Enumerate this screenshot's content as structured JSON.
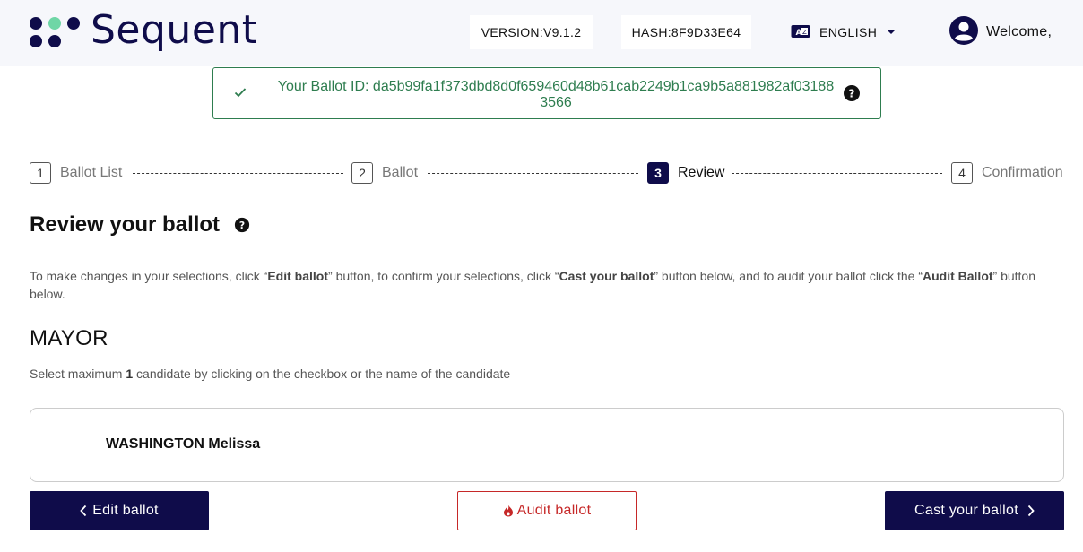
{
  "header": {
    "brand": "Sequent",
    "version": "VERSION:V9.1.2",
    "hash": "HASH:8F9D33E64",
    "language": "ENGLISH",
    "welcome": "Welcome,"
  },
  "banner": {
    "ballot_id_line1": "Your Ballot ID: da5b99fa1f373dbd8d0f659460d48b61cab2249b1ca9b5a881982af03188",
    "ballot_id_line2": "3566"
  },
  "stepper": {
    "steps": [
      {
        "number": "1",
        "label": "Ballot List",
        "state": "done"
      },
      {
        "number": "2",
        "label": "Ballot",
        "state": "done"
      },
      {
        "number": "3",
        "label": "Review",
        "state": "active"
      },
      {
        "number": "4",
        "label": "Confirmation",
        "state": "pending"
      }
    ]
  },
  "review": {
    "title": "Review your ballot",
    "instructions": {
      "p1": "To make changes in your selections, click “",
      "b1": "Edit ballot",
      "p2": "” button, to confirm your selections, click “",
      "b2": "Cast your ballot",
      "p3": "” button below, and to audit your ballot click the “",
      "b3": "Audit Ballot",
      "p4": "” button below."
    }
  },
  "contest": {
    "title": "MAYOR",
    "hint_pre": "Select maximum ",
    "hint_max": "1",
    "hint_post": " candidate by clicking on the checkbox or the name of the candidate",
    "candidates": [
      {
        "name": "WASHINGTON Melissa"
      }
    ]
  },
  "actions": {
    "edit": "Edit ballot",
    "audit": "Audit ballot",
    "cast": "Cast your ballot"
  },
  "colors": {
    "brand_navy": "#0f0c4a",
    "logo_green": "#6fd6a6",
    "success_green": "#2e7d4f",
    "audit_red": "#c62828"
  },
  "icons": {
    "logo": "sequent-dots-logo",
    "language": "language-translate-icon",
    "language_caret": "caret-down-icon",
    "user": "account-circle-icon",
    "banner_check": "check-icon",
    "help": "help-circle-icon",
    "edit": "chevron-left-icon",
    "audit": "fire-icon",
    "cast": "chevron-right-icon"
  }
}
